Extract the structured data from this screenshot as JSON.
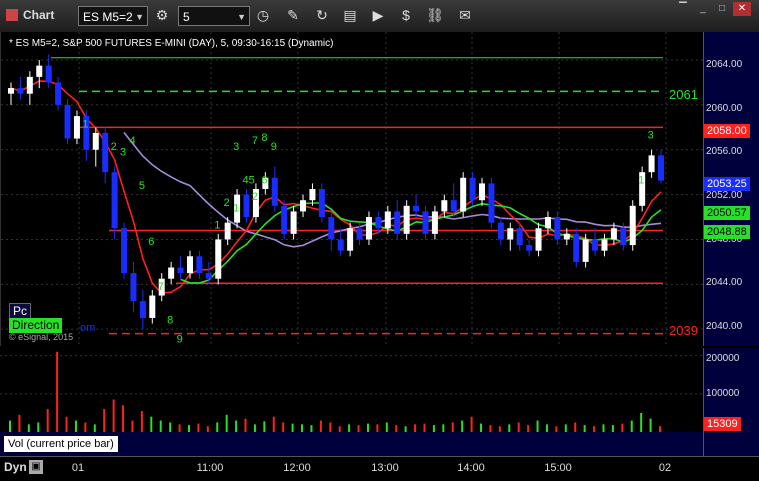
{
  "app": {
    "title": "Chart"
  },
  "toolbar": {
    "symbol_value": "ES M5=2",
    "interval_value": "5",
    "icons": [
      "settings-icon",
      "clock-icon",
      "pencil-icon",
      "refresh-icon",
      "news-icon",
      "play-icon",
      "dollar-icon",
      "link-icon",
      "comment-icon"
    ]
  },
  "chart": {
    "header": "* ES M5=2, S&P 500 FUTURES E-MINI (DAY), 5, 09:30-16:15 (Dynamic)",
    "price_ticks": [
      "2064.00",
      "2060.00",
      "2056.00",
      "2052.00",
      "2048.00",
      "2044.00",
      "2040.00"
    ],
    "level_upper_label": "2061",
    "level_lower_label": "2039",
    "price_tags": {
      "red": "2058.00",
      "last": "2053.25",
      "green1": "2050.57",
      "green2": "2048.88"
    },
    "pc_label": "Pc",
    "direction_label": "Direction",
    "om_label": "om",
    "copyright": "© eSignal, 2015",
    "count_labels": [
      "1",
      "2",
      "3",
      "4",
      "5",
      "6",
      "7",
      "8",
      "9",
      "3",
      "7",
      "8",
      "9",
      "45",
      "6",
      "2",
      "1",
      "1",
      "2",
      "3",
      "1"
    ],
    "colors": {
      "up": "#ffffff",
      "down": "#1a2dff",
      "red_line": "#ff2020",
      "green_line": "#28e028",
      "lavender": "#a58cd8"
    }
  },
  "volume": {
    "label": "Vol (current price bar)",
    "ticks": [
      "200000",
      "100000"
    ],
    "current_tag": "15309"
  },
  "time_axis": {
    "labels": [
      "01",
      "11:00",
      "12:00",
      "13:00",
      "14:00",
      "15:00",
      "02"
    ]
  },
  "footer": {
    "dyn_label": "Dyn"
  },
  "chart_data": {
    "type": "candlestick",
    "title": "ES M5=2, S&P 500 FUTURES E-MINI (DAY), 5, 09:30-16:15 (Dynamic)",
    "ylim": [
      2038.5,
      2066.5
    ],
    "yticks": [
      2040,
      2044,
      2048,
      2052,
      2056,
      2060,
      2064
    ],
    "x_labels": [
      "01",
      "11:00",
      "12:00",
      "13:00",
      "14:00",
      "15:00",
      "02"
    ],
    "levels": [
      2064.2,
      2061.2,
      2058.0,
      2048.8,
      2044.1,
      2039.6
    ],
    "last_price": 2053.25,
    "candles": [
      [
        2061.0,
        2062.0,
        2060.0,
        2061.5
      ],
      [
        2061.5,
        2062.5,
        2060.5,
        2061.0
      ],
      [
        2061.0,
        2063.0,
        2060.0,
        2062.5
      ],
      [
        2062.5,
        2064.0,
        2061.5,
        2063.5
      ],
      [
        2063.5,
        2064.5,
        2061.5,
        2062.0
      ],
      [
        2062.0,
        2062.5,
        2059.5,
        2060.0
      ],
      [
        2060.0,
        2060.5,
        2056.5,
        2057.0
      ],
      [
        2057.0,
        2059.5,
        2056.5,
        2059.0
      ],
      [
        2059.0,
        2059.5,
        2055.0,
        2056.0
      ],
      [
        2056.0,
        2058.0,
        2054.5,
        2057.5
      ],
      [
        2057.5,
        2058.0,
        2053.0,
        2054.0
      ],
      [
        2054.0,
        2054.5,
        2048.0,
        2049.0
      ],
      [
        2049.0,
        2049.5,
        2044.5,
        2045.0
      ],
      [
        2045.0,
        2046.0,
        2041.5,
        2042.5
      ],
      [
        2042.5,
        2043.5,
        2040.0,
        2041.0
      ],
      [
        2041.0,
        2043.5,
        2040.5,
        2043.0
      ],
      [
        2043.0,
        2045.0,
        2042.5,
        2044.5
      ],
      [
        2044.5,
        2046.0,
        2044.0,
        2045.5
      ],
      [
        2045.5,
        2046.5,
        2044.5,
        2045.0
      ],
      [
        2045.0,
        2047.0,
        2044.5,
        2046.5
      ],
      [
        2046.5,
        2047.0,
        2044.5,
        2045.0
      ],
      [
        2045.0,
        2046.0,
        2044.0,
        2044.5
      ],
      [
        2044.5,
        2048.5,
        2044.0,
        2048.0
      ],
      [
        2048.0,
        2050.0,
        2047.5,
        2049.5
      ],
      [
        2049.5,
        2052.5,
        2049.0,
        2052.0
      ],
      [
        2052.0,
        2052.5,
        2049.5,
        2050.0
      ],
      [
        2050.0,
        2053.0,
        2049.5,
        2052.5
      ],
      [
        2052.5,
        2054.0,
        2052.0,
        2053.5
      ],
      [
        2053.5,
        2054.5,
        2050.5,
        2051.0
      ],
      [
        2051.0,
        2051.5,
        2048.0,
        2048.5
      ],
      [
        2048.5,
        2051.0,
        2048.0,
        2050.5
      ],
      [
        2050.5,
        2052.0,
        2050.0,
        2051.5
      ],
      [
        2051.5,
        2053.0,
        2051.0,
        2052.5
      ],
      [
        2052.5,
        2053.0,
        2049.5,
        2050.0
      ],
      [
        2050.0,
        2050.5,
        2047.0,
        2048.0
      ],
      [
        2048.0,
        2049.0,
        2046.5,
        2047.0
      ],
      [
        2047.0,
        2049.5,
        2046.5,
        2049.0
      ],
      [
        2049.0,
        2049.5,
        2047.5,
        2048.0
      ],
      [
        2048.0,
        2050.5,
        2047.5,
        2050.0
      ],
      [
        2050.0,
        2050.5,
        2048.5,
        2049.0
      ],
      [
        2049.0,
        2051.0,
        2048.5,
        2050.5
      ],
      [
        2050.5,
        2051.5,
        2048.0,
        2048.5
      ],
      [
        2048.5,
        2051.5,
        2048.0,
        2051.0
      ],
      [
        2051.0,
        2052.0,
        2050.0,
        2050.5
      ],
      [
        2050.5,
        2051.0,
        2048.0,
        2048.5
      ],
      [
        2048.5,
        2051.0,
        2048.0,
        2050.5
      ],
      [
        2050.5,
        2052.0,
        2050.0,
        2051.5
      ],
      [
        2051.5,
        2053.0,
        2050.0,
        2050.5
      ],
      [
        2050.5,
        2054.0,
        2050.0,
        2053.5
      ],
      [
        2053.5,
        2054.0,
        2051.0,
        2051.5
      ],
      [
        2051.5,
        2053.5,
        2051.0,
        2053.0
      ],
      [
        2053.0,
        2053.5,
        2049.0,
        2049.5
      ],
      [
        2049.5,
        2050.0,
        2047.5,
        2048.0
      ],
      [
        2048.0,
        2049.5,
        2047.0,
        2049.0
      ],
      [
        2049.0,
        2049.5,
        2047.0,
        2047.5
      ],
      [
        2047.5,
        2048.0,
        2046.5,
        2047.0
      ],
      [
        2047.0,
        2049.5,
        2046.5,
        2049.0
      ],
      [
        2049.0,
        2050.5,
        2048.5,
        2050.0
      ],
      [
        2050.0,
        2050.5,
        2047.5,
        2048.0
      ],
      [
        2048.0,
        2049.0,
        2047.5,
        2048.5
      ],
      [
        2048.5,
        2049.0,
        2045.5,
        2046.0
      ],
      [
        2046.0,
        2048.5,
        2045.5,
        2048.0
      ],
      [
        2048.0,
        2049.0,
        2046.5,
        2047.0
      ],
      [
        2047.0,
        2048.5,
        2046.5,
        2048.0
      ],
      [
        2048.0,
        2049.5,
        2047.5,
        2049.0
      ],
      [
        2049.0,
        2049.5,
        2047.0,
        2047.5
      ],
      [
        2047.5,
        2051.5,
        2047.0,
        2051.0
      ],
      [
        2051.0,
        2054.5,
        2050.5,
        2054.0
      ],
      [
        2054.0,
        2056.0,
        2053.5,
        2055.5
      ],
      [
        2055.5,
        2056.0,
        2053.0,
        2053.25
      ]
    ],
    "volume": [
      30000,
      45000,
      20000,
      25000,
      60000,
      210000,
      40000,
      30000,
      25000,
      20000,
      60000,
      85000,
      70000,
      30000,
      55000,
      40000,
      30000,
      25000,
      20000,
      18000,
      22000,
      15000,
      25000,
      45000,
      30000,
      35000,
      20000,
      28000,
      40000,
      25000,
      22000,
      20000,
      18000,
      30000,
      25000,
      15000,
      20000,
      18000,
      22000,
      20000,
      25000,
      18000,
      15000,
      20000,
      22000,
      18000,
      20000,
      25000,
      30000,
      40000,
      22000,
      18000,
      15000,
      20000,
      25000,
      18000,
      30000,
      20000,
      15000,
      20000,
      25000,
      18000,
      15000,
      20000,
      18000,
      22000,
      30000,
      50000,
      35000,
      15309
    ]
  }
}
